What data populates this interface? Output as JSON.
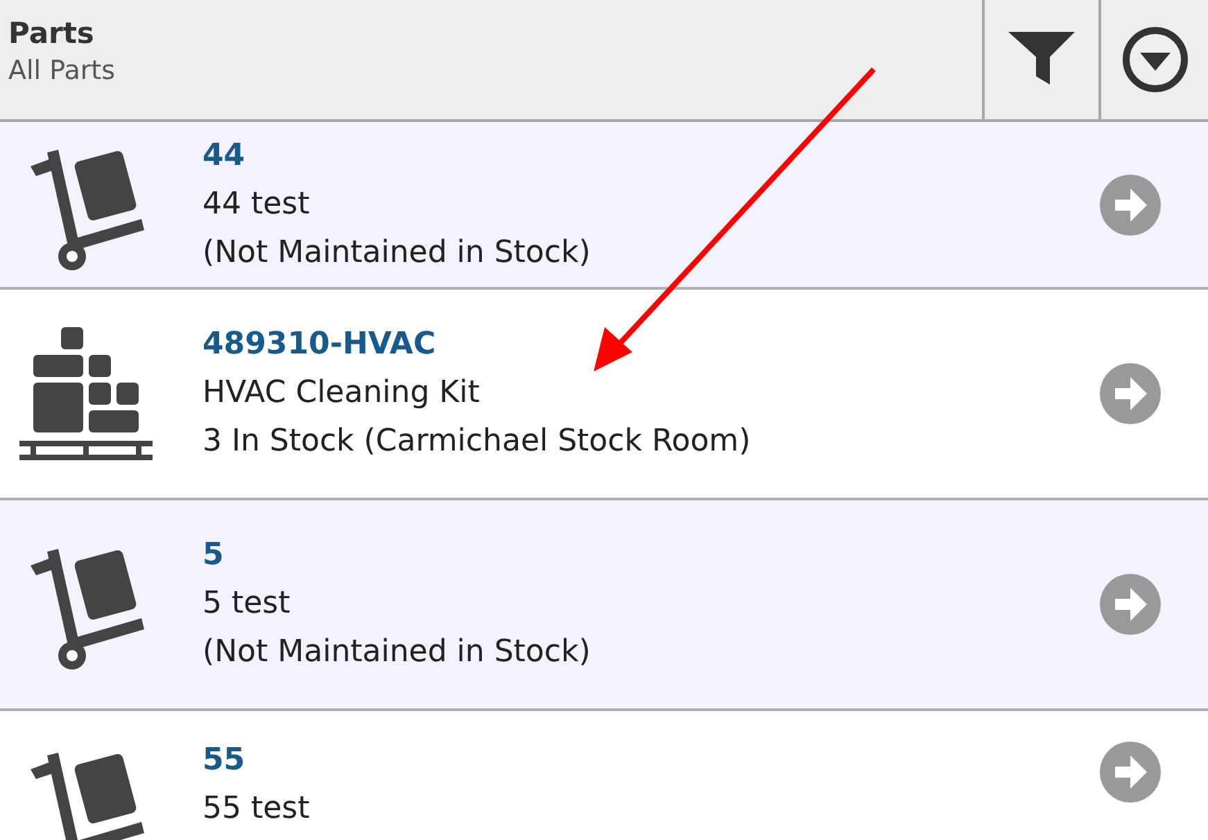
{
  "header": {
    "title": "Parts",
    "subtitle": "All Parts"
  },
  "parts": [
    {
      "kind": "hand-truck",
      "number": "44",
      "description": "44 test",
      "stock": "(Not Maintained in Stock)"
    },
    {
      "kind": "pallet",
      "number": "489310-HVAC",
      "description": "HVAC Cleaning Kit",
      "stock": "3 In Stock (Carmichael Stock Room)"
    },
    {
      "kind": "hand-truck",
      "number": "5",
      "description": "5 test",
      "stock": "(Not Maintained in Stock)"
    },
    {
      "kind": "hand-truck",
      "number": "55",
      "description": "55 test"
    }
  ]
}
